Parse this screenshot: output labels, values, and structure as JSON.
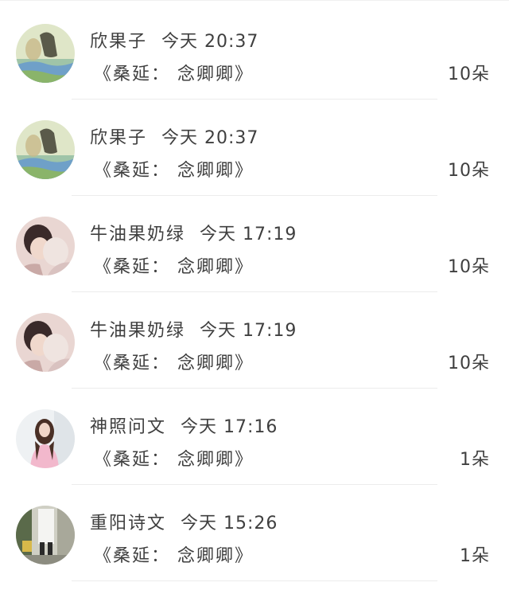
{
  "gifts": [
    {
      "name": "欣果子",
      "time": "今天 20:37",
      "title": "《桑延： 念卿卿》",
      "count": "10朵",
      "avatar_icon": "avatar-landscape-icon"
    },
    {
      "name": "欣果子",
      "time": "今天 20:37",
      "title": "《桑延： 念卿卿》",
      "count": "10朵",
      "avatar_icon": "avatar-landscape-icon"
    },
    {
      "name": "牛油果奶绿",
      "time": "今天 17:19",
      "title": "《桑延： 念卿卿》",
      "count": "10朵",
      "avatar_icon": "avatar-couple-icon"
    },
    {
      "name": "牛油果奶绿",
      "time": "今天 17:19",
      "title": "《桑延： 念卿卿》",
      "count": "10朵",
      "avatar_icon": "avatar-couple-icon"
    },
    {
      "name": "神照问文",
      "time": "今天 17:16",
      "title": "《桑延： 念卿卿》",
      "count": "1朵",
      "avatar_icon": "avatar-girl-icon"
    },
    {
      "name": "重阳诗文",
      "time": "今天 15:26",
      "title": "《桑延： 念卿卿》",
      "count": "1朵",
      "avatar_icon": "avatar-street-icon"
    }
  ]
}
